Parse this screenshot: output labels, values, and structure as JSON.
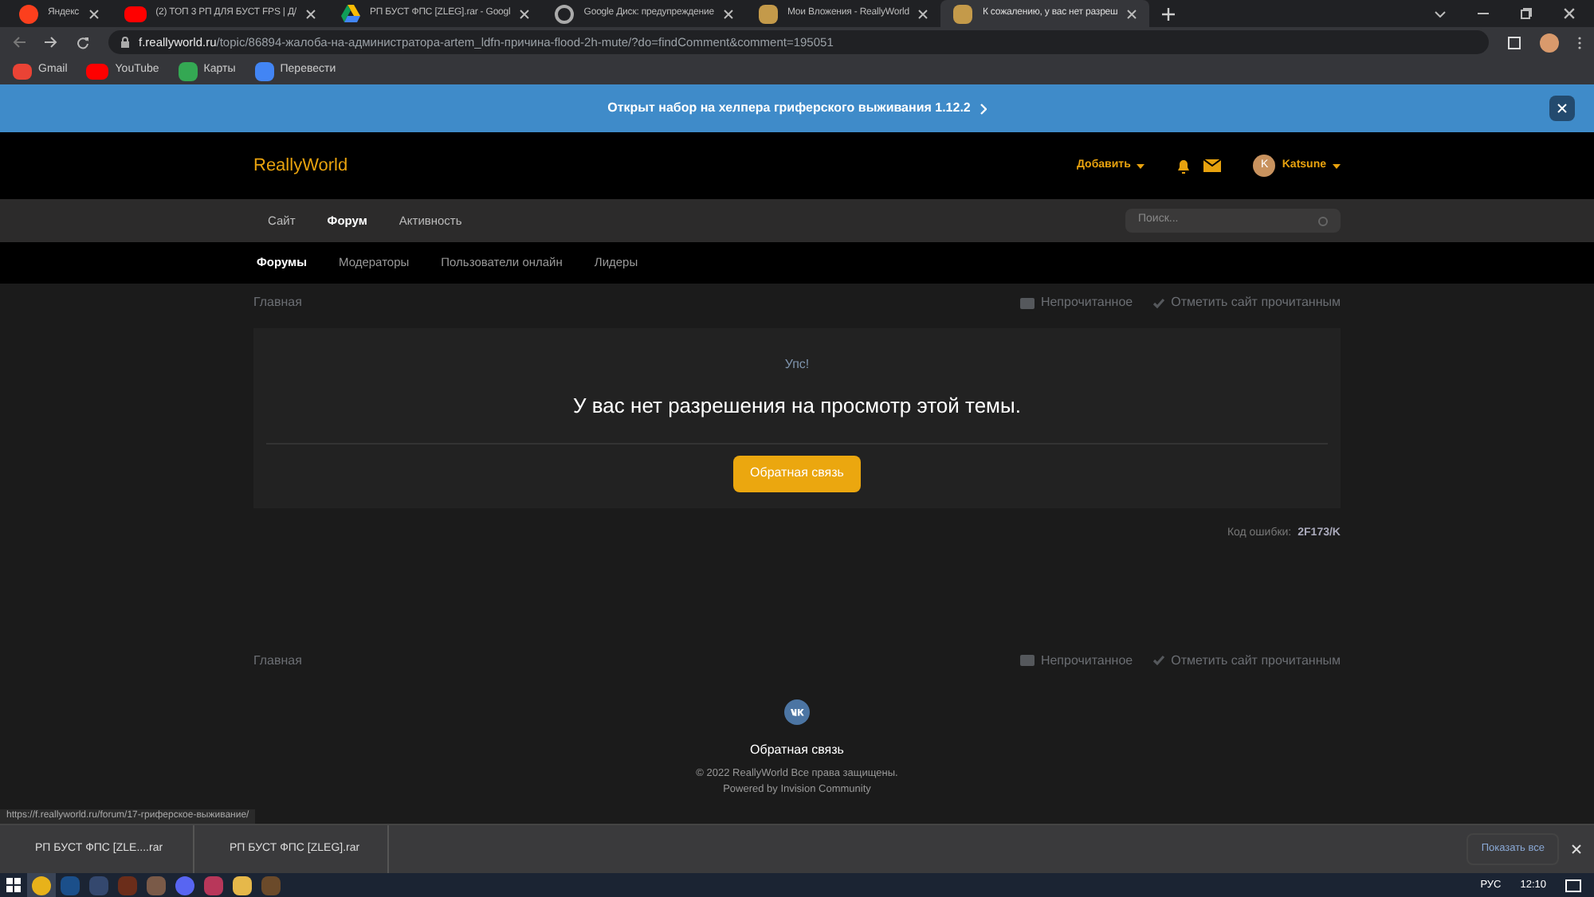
{
  "browser_tabs": [
    {
      "title": "Яндекс",
      "selected": false,
      "kind": "yandex"
    },
    {
      "title": "(2) ТОП 3 РП ДЛЯ БУСТ FPS | Д/",
      "selected": false,
      "kind": "youtube"
    },
    {
      "title": "РП БУСТ ФПС [ZLEG].rar - Googl",
      "selected": false,
      "kind": "drive"
    },
    {
      "title": "Google Диск: предупреждение",
      "selected": false,
      "kind": "globe"
    },
    {
      "title": "Мои Вложения - ReallyWorld",
      "selected": false,
      "kind": "site"
    },
    {
      "title": "К сожалению, у вас нет разреш",
      "selected": true,
      "kind": "site"
    }
  ],
  "address_bar": {
    "host": "f.reallyworld.ru",
    "path": "/topic/86894-жалоба-на-администратора-artem_ldfn-причина-flood-2h-mute/?do=findComment&comment=195051"
  },
  "bookmarks": [
    {
      "label": "Gmail",
      "kind": "gmail"
    },
    {
      "label": "YouTube",
      "kind": "youtube"
    },
    {
      "label": "Карты",
      "kind": "maps"
    },
    {
      "label": "Перевести",
      "kind": "translate"
    }
  ],
  "banner": {
    "text": "Открыт набор на хелпера гриферского выживания 1.12.2"
  },
  "site": {
    "logo": "ReallyWorld",
    "add_menu": "Добавить",
    "user_initial": "K",
    "user_name": "Katsune"
  },
  "nav": [
    {
      "label": "Сайт",
      "selected": false
    },
    {
      "label": "Форум",
      "selected": true
    },
    {
      "label": "Активность",
      "selected": false
    }
  ],
  "search": {
    "placeholder": "Поиск..."
  },
  "subnav": [
    {
      "label": "Форумы",
      "selected": true
    },
    {
      "label": "Модераторы",
      "selected": false
    },
    {
      "label": "Пользователи онлайн",
      "selected": false
    },
    {
      "label": "Лидеры",
      "selected": false
    }
  ],
  "breadcrumb_top": {
    "home": "Главная",
    "unread": "Непрочитанное",
    "mark_read": "Отметить сайт прочитанным"
  },
  "error_box": {
    "title": "Упс!",
    "message": "У вас нет разрешения на просмотр этой темы.",
    "button": "Обратная связь"
  },
  "error_code": {
    "label": "Код ошибки:",
    "code": "2F173/K"
  },
  "breadcrumb_bottom": {
    "home": "Главная",
    "unread": "Непрочитанное",
    "mark_read": "Отметить сайт прочитанным"
  },
  "footer": {
    "link": "Обратная связь",
    "copyright": "© 2022 ReallyWorld Все права защищены.",
    "powered": "Powered by Invision Community"
  },
  "status_url": "https://f.reallyworld.ru/forum/17-гриферское-выживание/",
  "downloads": [
    {
      "name": "РП БУСТ ФПС [ZLE....rar"
    },
    {
      "name": "РП БУСТ ФПС [ZLEG].rar"
    }
  ],
  "show_all": "Показать все",
  "taskbar": {
    "apps": [
      {
        "kind": "chrome",
        "selected": true
      },
      {
        "kind": "steam",
        "selected": false
      },
      {
        "kind": "dark",
        "selected": false
      },
      {
        "kind": "shield",
        "selected": false
      },
      {
        "kind": "face",
        "selected": false
      },
      {
        "kind": "discord",
        "selected": false
      },
      {
        "kind": "winrar",
        "selected": false
      },
      {
        "kind": "folder",
        "selected": false
      },
      {
        "kind": "minecraft",
        "selected": false
      }
    ],
    "lang": "РУС",
    "time": "12:10"
  }
}
